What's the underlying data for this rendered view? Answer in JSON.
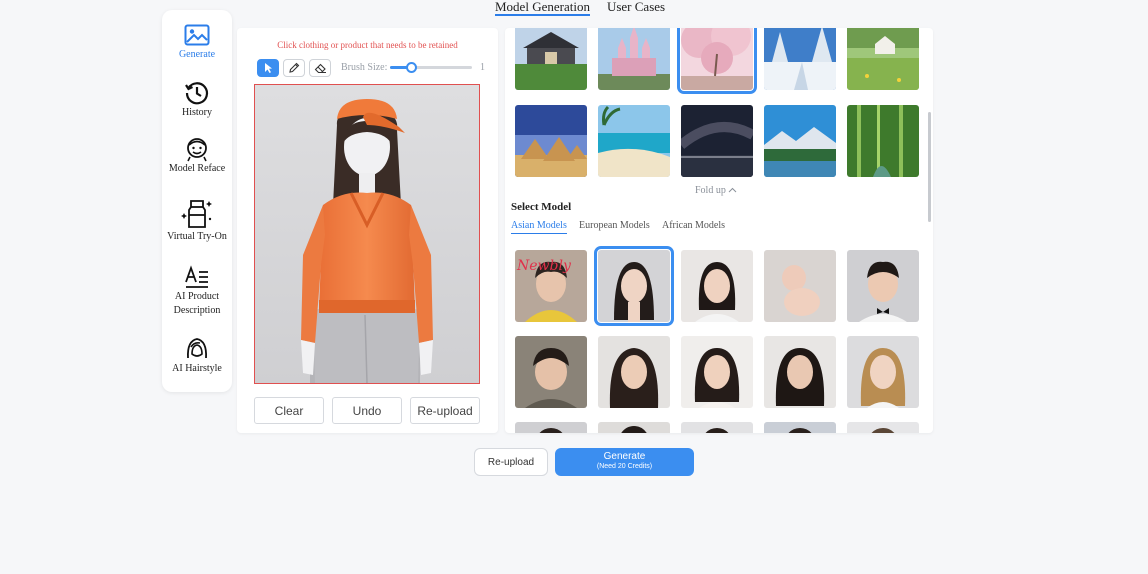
{
  "top_tabs": [
    "Model Generation",
    "User Cases"
  ],
  "sidebar": {
    "items": [
      {
        "label": "Generate",
        "icon": "image-icon"
      },
      {
        "label": "History",
        "icon": "history-icon"
      },
      {
        "label": "Model Reface",
        "icon": "face-icon"
      },
      {
        "label": "Virtual Try-On",
        "icon": "clothing-icon"
      },
      {
        "label": "AI Product Description",
        "icon": "text-icon"
      },
      {
        "label": "AI Hairstyle",
        "icon": "hair-icon"
      }
    ]
  },
  "editor": {
    "hint": "Click clothing or product that needs to be retained",
    "brush_label": "Brush Size:",
    "brush_value": "1",
    "brush_level_fraction": 0.25,
    "buttons": {
      "clear": "Clear",
      "undo": "Undo",
      "reupload": "Re-upload"
    }
  },
  "backgrounds": {
    "scenes": [
      "castle",
      "pink-castle",
      "cherry-blossom",
      "snow-forest",
      "meadow-house",
      "pyramids",
      "beach",
      "night-sky",
      "mountain-lake",
      "bamboo-forest"
    ],
    "selected": "cherry-blossom",
    "fold_label": "Fold up"
  },
  "select_model": {
    "title": "Select Model",
    "tabs": [
      "Asian Models",
      "European Models",
      "African Models"
    ],
    "active_tab": "Asian Models",
    "watermark_text": "Newbly"
  },
  "bottom": {
    "reupload": "Re-upload",
    "generate": "Generate",
    "credits": "(Need 20 Credits)"
  },
  "colors": {
    "accent": "#3b8ef0",
    "hint": "#e25252"
  }
}
